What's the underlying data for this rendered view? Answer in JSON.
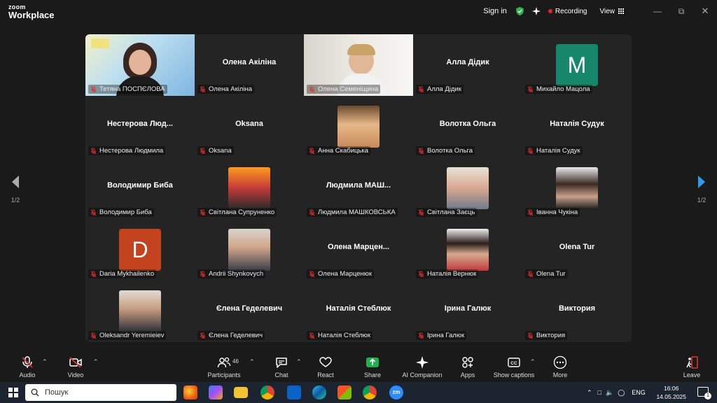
{
  "titlebar": {
    "logo_top": "zoom",
    "logo_bottom": "Workplace",
    "sign_in": "Sign in",
    "recording": "Recording",
    "view": "View",
    "recording_color": "#e02828"
  },
  "gallery": {
    "page_left": "1/2",
    "page_right": "1/2",
    "tiles": [
      {
        "name": "Тетяна ПОСПЄЛОВА",
        "display": "",
        "type": "video"
      },
      {
        "name": "Олена Акіліна",
        "display": "Олена Акіліна",
        "type": "name"
      },
      {
        "name": "Олена Семеніщина",
        "display": "",
        "type": "video"
      },
      {
        "name": "Алла Дідик",
        "display": "Алла Дідик",
        "type": "name"
      },
      {
        "name": "Михайло Мацола",
        "display": "",
        "type": "avatar",
        "letter": "M",
        "color": "#17876b"
      },
      {
        "name": "Нестерова Людмила",
        "display": "Нестерова  Люд...",
        "type": "name"
      },
      {
        "name": "Oksana",
        "display": "Oksana",
        "type": "name"
      },
      {
        "name": "Анна Скабицька",
        "display": "",
        "type": "photo"
      },
      {
        "name": "Волотка Ольга",
        "display": "Волотка Ольга",
        "type": "name"
      },
      {
        "name": "Наталія Судук",
        "display": "Наталія Судук",
        "type": "name"
      },
      {
        "name": "Володимир Биба",
        "display": "Володимир Биба",
        "type": "name"
      },
      {
        "name": "Світлана Супруненко",
        "display": "",
        "type": "photo"
      },
      {
        "name": "Людмила МАШКОВСЬКА",
        "display": "Людмила  МАШ...",
        "type": "name"
      },
      {
        "name": "Світлана Заєць",
        "display": "",
        "type": "photo"
      },
      {
        "name": "Іванна Чукіна",
        "display": "",
        "type": "photo"
      },
      {
        "name": "Daria Mykhailenko",
        "display": "",
        "type": "avatar",
        "letter": "D",
        "color": "#c2431e"
      },
      {
        "name": "Andrii Shynkovych",
        "display": "",
        "type": "photo"
      },
      {
        "name": "Олена Марценюк",
        "display": "Олена  Марцен...",
        "type": "name"
      },
      {
        "name": "Наталія Вернюк",
        "display": "",
        "type": "photo"
      },
      {
        "name": "Olena Tur",
        "display": "Olena Tur",
        "type": "name"
      },
      {
        "name": "Oleksandr Yeremieiev",
        "display": "",
        "type": "photo"
      },
      {
        "name": "Єлена Геделевич",
        "display": "Єлена Геделевич",
        "type": "name"
      },
      {
        "name": "Наталія Стеблюк",
        "display": "Наталія Стеблюк",
        "type": "name"
      },
      {
        "name": "Ірина Галюк",
        "display": "Ірина Галюк",
        "type": "name"
      },
      {
        "name": "Виктория",
        "display": "Виктория",
        "type": "name"
      }
    ]
  },
  "toolbar": {
    "audio": "Audio",
    "video": "Video",
    "participants": "Participants",
    "participants_count": "46",
    "chat": "Chat",
    "react": "React",
    "share": "Share",
    "ai_companion": "AI Companion",
    "apps": "Apps",
    "show_captions": "Show captions",
    "more": "More",
    "leave": "Leave",
    "share_color": "#21b14a",
    "leave_color": "#e0332f"
  },
  "taskbar": {
    "search_placeholder": "Пошук",
    "lang": "ENG",
    "time": "16:06",
    "date": "14.05.2025",
    "notif_count": "1"
  }
}
